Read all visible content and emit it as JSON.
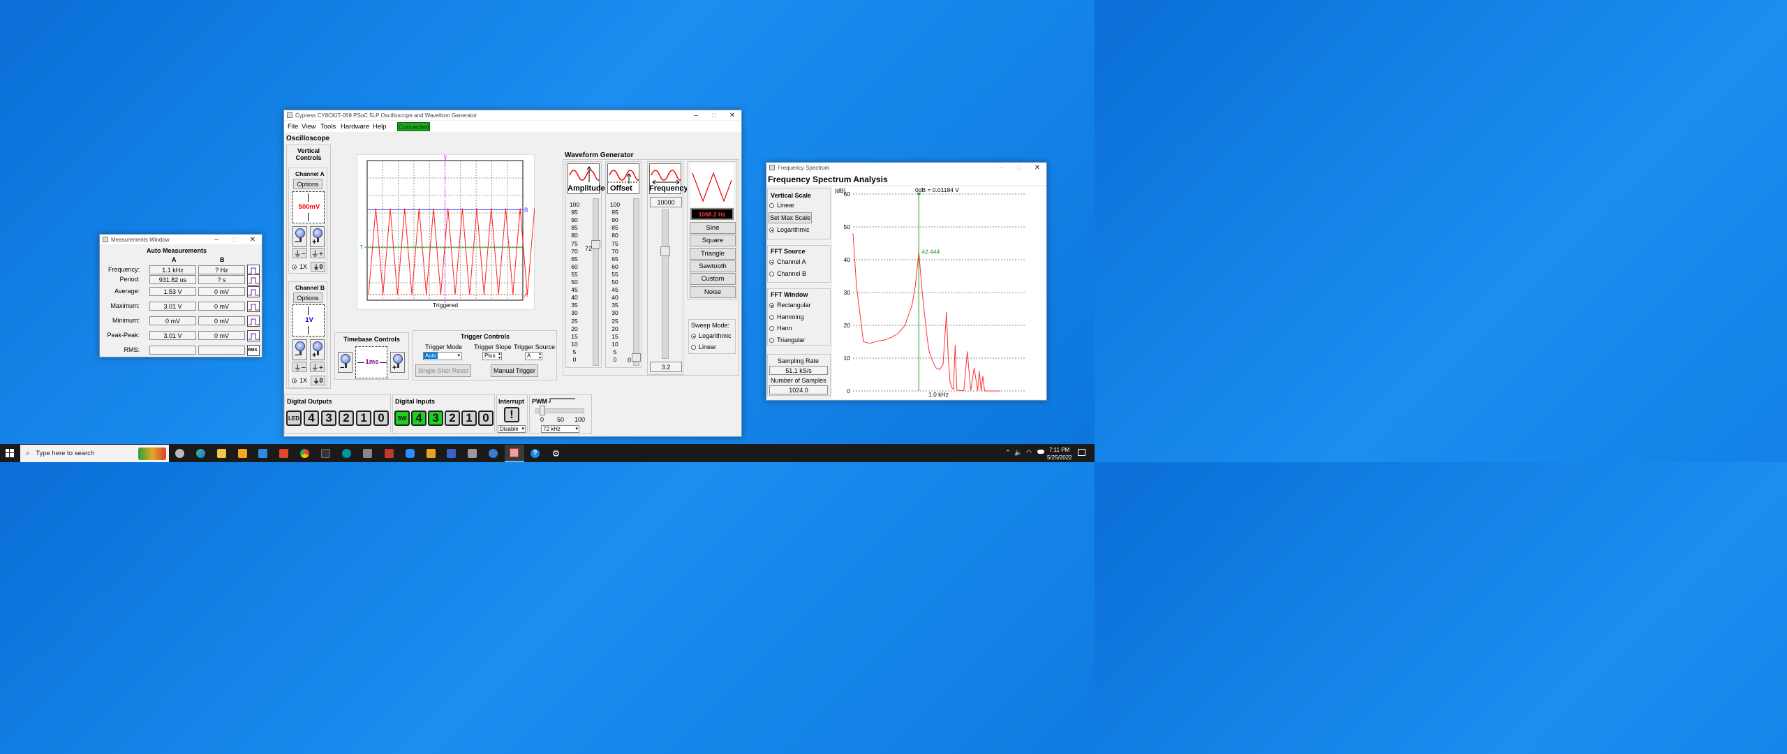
{
  "desktop": {
    "taskbar": {
      "search_placeholder": "Type here to search",
      "time": "7:11 PM",
      "date": "5/25/2022"
    }
  },
  "measurements": {
    "title": "Measurements Window",
    "heading": "Auto Measurements",
    "col_a": "A",
    "col_b": "B",
    "rows": [
      {
        "label": "Frequency:",
        "a": "1.1 kHz",
        "b": "? Hz"
      },
      {
        "label": "Period:",
        "a": "931.82 us",
        "b": "? s"
      },
      {
        "label": "Average:",
        "a": "1.53 V",
        "b": "0 mV"
      },
      {
        "label": "Maximum:",
        "a": "3.01 V",
        "b": "0 mV"
      },
      {
        "label": "Minimum:",
        "a": "0 mV",
        "b": "0 mV"
      },
      {
        "label": "Peak-Peak:",
        "a": "3.01 V",
        "b": "0 mV"
      },
      {
        "label": "RMS:",
        "a": "",
        "b": ""
      }
    ],
    "rms_icon_text": "RMS"
  },
  "scope": {
    "title": "Cypress CY8CKIT-059 PSoC 5LP Oscilloscope and Waveform Generator",
    "menu": [
      "File",
      "View",
      "Tools",
      "Hardware",
      "Help"
    ],
    "status": "Connected",
    "status_color": "#1fa81f",
    "osc_heading": "Oscilloscope",
    "vertical_controls": "Vertical Controls",
    "channel_a": {
      "label": "Channel A",
      "options": "Options",
      "scale": "500mV",
      "scale_color": "#ff0000",
      "probe": "1X",
      "gnd_zero": "0"
    },
    "channel_b": {
      "label": "Channel B",
      "options": "Options",
      "scale": "1V",
      "scale_color": "#0000ff",
      "probe": "1X",
      "gnd_zero": "0"
    },
    "plot": {
      "status": "Triggered",
      "label_y": "Y",
      "label_t": "T",
      "label_b": "B",
      "label_a": "A"
    },
    "timebase": {
      "heading": "Timebase Controls",
      "value": "1ms",
      "value_color": "#8b008b"
    },
    "trigger": {
      "heading": "Trigger Controls",
      "mode_label": "Trigger Mode",
      "mode_value": "Auto",
      "slope_label": "Trigger Slope",
      "slope_value": "Plus",
      "source_label": "Trigger Source",
      "source_value": "A",
      "single_shot": "Single-Shot Reset",
      "manual": "Manual Trigger"
    },
    "digital_outputs": {
      "heading": "Digital Outputs",
      "led": "LED",
      "digits": [
        "4",
        "3",
        "2",
        "1",
        "0"
      ]
    },
    "digital_inputs": {
      "heading": "Digital Inputs",
      "sw": "SW",
      "digits": [
        "4",
        "3",
        "2",
        "1",
        "0"
      ],
      "on": [
        true,
        true,
        true,
        false,
        false,
        false
      ]
    },
    "interrupt": {
      "heading": "Interrupt",
      "icon": "!",
      "select": "Disable"
    },
    "pwm": {
      "heading": "PWM",
      "ticks": [
        "0",
        "50",
        "100"
      ],
      "select": "72 kHz",
      "level_fraction": 0.1
    },
    "wavegen": {
      "heading": "Waveform Generator",
      "amp_label": "Amplitude",
      "off_label": "Offset",
      "freq_label": "Frequency",
      "scale_ticks": [
        "100",
        "95",
        "90",
        "85",
        "80",
        "75",
        "70",
        "65",
        "60",
        "55",
        "50",
        "45",
        "40",
        "35",
        "30",
        "25",
        "20",
        "15",
        "10",
        "5",
        "0"
      ],
      "amp_value": "72",
      "amp_level": 0.72,
      "off_value": "0",
      "off_level": 0.0,
      "freq_value": "10000",
      "freq_bottom": "3.2",
      "freq_level": 0.72,
      "freq_readout": "1068.2 Hz",
      "freq_readout_color": "#ff3b3b",
      "buttons": [
        "Sine",
        "Square",
        "Triangle",
        "Sawtooth",
        "Custom",
        "Noise"
      ],
      "sweep_label": "Sweep Mode:",
      "sweep_log": "Logarithmic",
      "sweep_lin": "Linear"
    }
  },
  "fft": {
    "title": "Frequency Spectrum",
    "heading": "Frequency Spectrum Analysis",
    "vertical_scale": "Vertical Scale",
    "linear": "Linear",
    "set_max": "Set Max Scale",
    "logarithmic": "Logarithmic",
    "source_heading": "FFT Source",
    "ch_a": "Channel A",
    "ch_b": "Channel B",
    "window_heading": "FFT Window",
    "windows": [
      "Rectangular",
      "Hamming",
      "Hann",
      "Triangular"
    ],
    "sampling_rate_label": "Sampling Rate",
    "sampling_rate": "51.1 kS/s",
    "samples_label": "Number of Samples",
    "samples": "1024.0",
    "unit_label": "[dB]",
    "ref_label": "0dB = 0.01184 V",
    "marker_label": "42.444",
    "x_tick_label": "1.0 kHz"
  },
  "chart_data": {
    "type": "line",
    "title": "",
    "ylabel": "[dB]",
    "xlabel": "",
    "ylim": [
      0,
      60
    ],
    "y_ticks": [
      "60",
      "50",
      "40",
      "30",
      "20",
      "10",
      "0"
    ],
    "grid": true,
    "series": [
      {
        "color": "#ff3030",
        "x": [
          0.0,
          0.02,
          0.06,
          0.1,
          0.14,
          0.18,
          0.22,
          0.26,
          0.3,
          0.34,
          0.36,
          0.38,
          0.4,
          0.42,
          0.43,
          0.44,
          0.46,
          0.48,
          0.5,
          0.52,
          0.54,
          0.55,
          0.56,
          0.57,
          0.58,
          0.59,
          0.6,
          0.61,
          0.62,
          0.64,
          0.66,
          0.68,
          0.7,
          0.72,
          0.73,
          0.74,
          0.75,
          0.76,
          0.77,
          0.78,
          0.79,
          0.8,
          0.81,
          0.82,
          0.83,
          0.84,
          0.85
        ],
        "y": [
          48,
          32,
          15,
          14.5,
          15.2,
          15.5,
          16.3,
          17.5,
          20,
          26,
          32,
          42.4,
          30,
          20,
          15.5,
          12,
          9,
          7,
          6.5,
          8,
          24,
          10,
          3,
          1,
          0.5,
          14,
          0.3,
          0.2,
          0.1,
          0.1,
          12,
          0.2,
          7,
          0.1,
          6,
          0.1,
          4.5,
          0.1,
          0,
          0,
          0,
          0,
          0,
          0,
          0,
          0,
          0
        ]
      }
    ]
  }
}
